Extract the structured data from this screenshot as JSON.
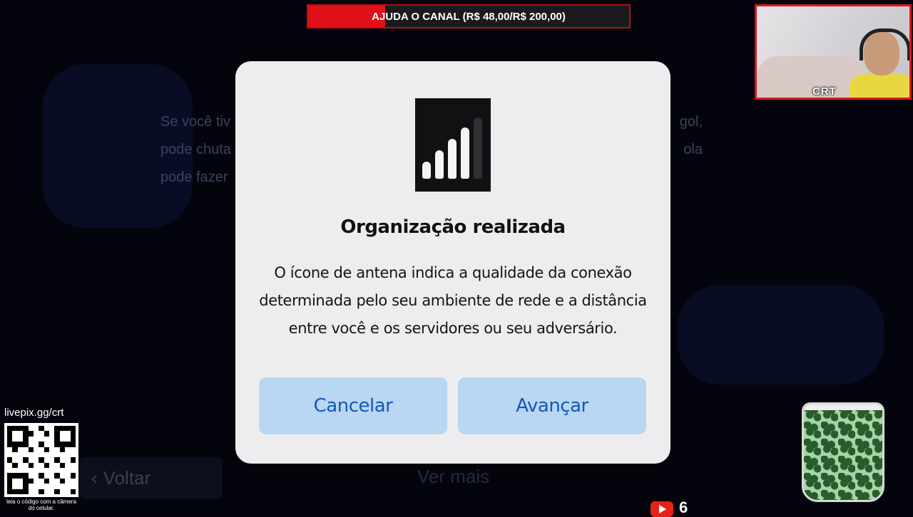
{
  "overlay": {
    "donation_goal": {
      "label": "AJUDA O CANAL (R$ 48,00/R$ 200,00)",
      "progress_fraction": 0.24
    },
    "webcam": {
      "tag": "CRT"
    },
    "livepix": {
      "url": "livepix.gg/crt",
      "caption": "leia o código com a câmera do celular."
    },
    "viewer_count": "6"
  },
  "background": {
    "text_lines": [
      {
        "left": "Se você tiv",
        "right": "gol,"
      },
      {
        "left": "pode chuta",
        "right": "ola"
      },
      {
        "left": "pode fazer",
        "right": ""
      }
    ],
    "back_label": "Voltar",
    "more_label": "Ver mais"
  },
  "dialog": {
    "icon": "signal-strength-icon",
    "title": "Organização realizada",
    "body_lines": [
      "O ícone de antena indica a qualidade da conexão",
      "determinada pelo seu ambiente de rede e a distância",
      "entre você e os servidores ou seu adversário."
    ],
    "cancel_label": "Cancelar",
    "confirm_label": "Avançar"
  },
  "colors": {
    "dialog_bg": "#ededf0",
    "button_bg": "#b9d6f2",
    "button_text": "#1458b4",
    "accent_red": "#e01019"
  }
}
